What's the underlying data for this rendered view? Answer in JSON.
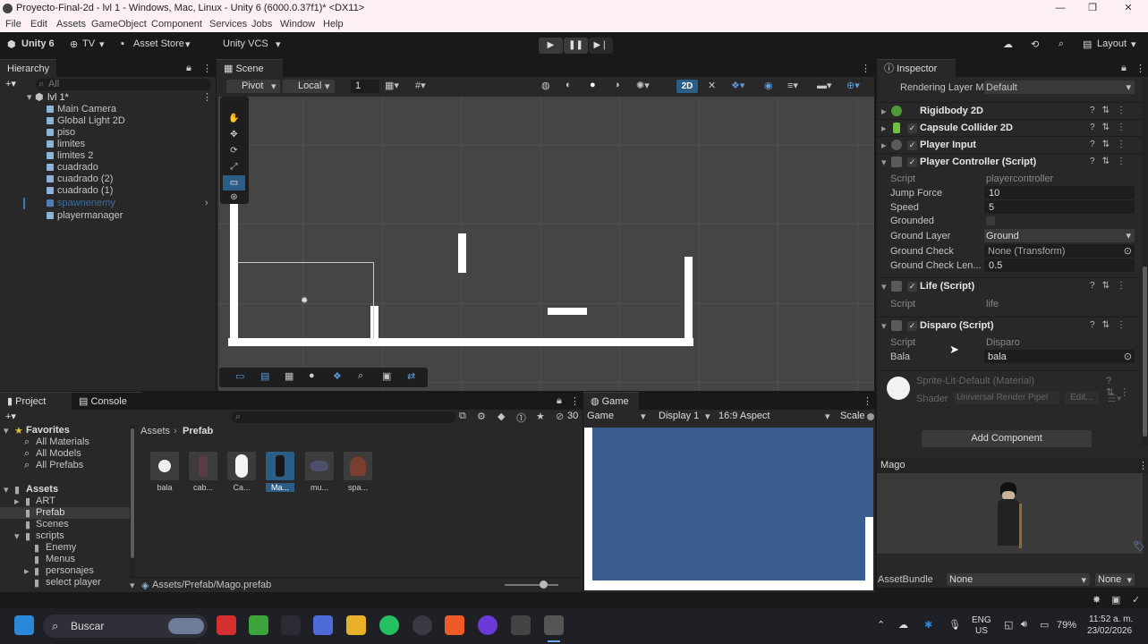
{
  "window": {
    "title": "Proyecto-Final-2d - lvl 1 - Windows, Mac, Linux - Unity 6 (6000.0.37f1)* <DX11>"
  },
  "menu": [
    "File",
    "Edit",
    "Assets",
    "GameObject",
    "Component",
    "Services",
    "Jobs",
    "Window",
    "Help"
  ],
  "toolbar": {
    "account": "Unity 6",
    "tv": "TV",
    "asset_store": "Asset Store",
    "vcs": "Unity VCS",
    "layout": "Layout"
  },
  "hierarchy": {
    "tab": "Hierarchy",
    "search_placeholder": "All",
    "scene": "lvl 1*",
    "items": [
      "Main Camera",
      "Global Light 2D",
      "piso",
      "limites",
      "limites 2",
      "cuadrado",
      "cuadrado (2)",
      "cuadrado (1)",
      "spawnenemy",
      "playermanager"
    ]
  },
  "scene": {
    "tab": "Scene",
    "pivot": "Pivot",
    "local": "Local",
    "grid_value": "1",
    "mode_2d": "2D"
  },
  "inspector": {
    "tab": "Inspector",
    "rendering_layer_label": "Rendering Layer M:",
    "rendering_layer_value": "Default",
    "components": {
      "rigidbody": "Rigidbody 2D",
      "capsule": "Capsule Collider 2D",
      "player_input": "Player Input",
      "player_controller": "Player Controller (Script)",
      "life": "Life (Script)",
      "disparo": "Disparo (Script)"
    },
    "pc_fields": {
      "script_label": "Script",
      "script_value": "playercontroller",
      "jump_label": "Jump Force",
      "jump_value": "10",
      "speed_label": "Speed",
      "speed_value": "5",
      "grounded_label": "Grounded",
      "ground_layer_label": "Ground Layer",
      "ground_layer_value": "Ground",
      "ground_check_label": "Ground Check",
      "ground_check_value": "None (Transform)",
      "ground_check_len_label": "Ground Check Len...",
      "ground_check_len_value": "0.5"
    },
    "life_fields": {
      "script_label": "Script",
      "script_value": "life"
    },
    "disparo_fields": {
      "script_label": "Script",
      "script_value": "Disparo",
      "bala_label": "Bala",
      "bala_value": "bala"
    },
    "material": {
      "name": "Sprite-Lit-Default (Material)",
      "shader_label": "Shader",
      "shader_value": "Universal Render Pipel",
      "edit": "Edit..."
    },
    "add_component": "Add Component",
    "preview_title": "Mago",
    "assetbundle_label": "AssetBundle",
    "assetbundle_value": "None",
    "assetbundle_variant": "None"
  },
  "project": {
    "tab": "Project",
    "console_tab": "Console",
    "count": "30",
    "favorites": {
      "title": "Favorites",
      "items": [
        "All Materials",
        "All Models",
        "All Prefabs"
      ]
    },
    "assets": {
      "title": "Assets",
      "items": [
        "ART",
        "Prefab",
        "Scenes",
        "scripts",
        "Enemy",
        "Menus",
        "personajes",
        "select player"
      ]
    },
    "breadcrumb_root": "Assets",
    "breadcrumb_folder": "Prefab",
    "prefabs": [
      "bala",
      "cab...",
      "Ca...",
      "Ma...",
      "mu...",
      "spa..."
    ],
    "path": "Assets/Prefab/Mago.prefab"
  },
  "game": {
    "tab": "Game",
    "mode": "Game",
    "display": "Display 1",
    "aspect": "16:9 Aspect",
    "scale": "Scale"
  },
  "taskbar": {
    "search": "Buscar",
    "lang": "ENG",
    "region": "US",
    "battery": "79%",
    "time": "11:52 a. m.",
    "date": "23/02/2026"
  },
  "colors": {
    "game_bg": "#3b5c8f",
    "selection": "#2c5d87"
  }
}
